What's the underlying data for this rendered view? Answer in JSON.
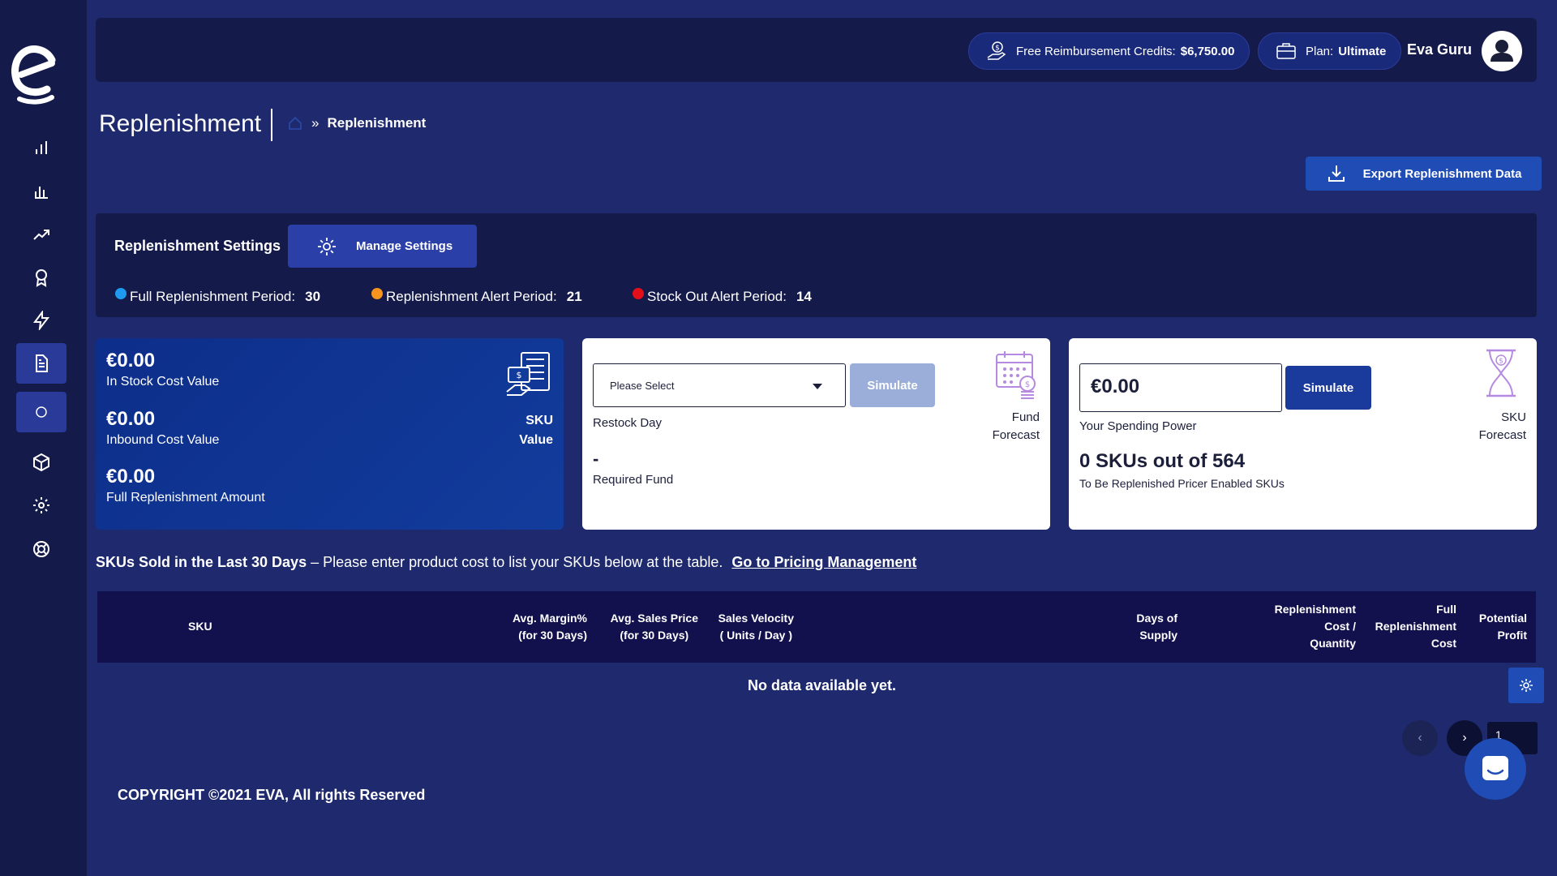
{
  "header": {
    "credits_label": "Free Reimbursement Credits:",
    "credits_value": "$6,750.00",
    "plan_label": "Plan:",
    "plan_value": "Ultimate",
    "user_name": "Eva Guru"
  },
  "page": {
    "title": "Replenishment",
    "breadcrumb_current": "Replenishment",
    "breadcrumb_separator": "»",
    "export_label": "Export Replenishment Data"
  },
  "settings": {
    "title": "Replenishment Settings",
    "manage_label": "Manage Settings",
    "full_period_label": "Full Replenishment Period:",
    "full_period_value": "30",
    "alert_period_label": "Replenishment Alert Period:",
    "alert_period_value": "21",
    "stockout_period_label": "Stock Out Alert Period:",
    "stockout_period_value": "14",
    "colors": {
      "full": "#1e9bf0",
      "alert": "#f7941d",
      "stockout": "#e3101a"
    }
  },
  "sku_value_card": {
    "in_stock_value": "€0.00",
    "in_stock_label": "In Stock Cost Value",
    "inbound_value": "€0.00",
    "inbound_label": "Inbound Cost Value",
    "full_amount_value": "€0.00",
    "full_amount_label": "Full Replenishment Amount",
    "corner_line1": "SKU",
    "corner_line2": "Value",
    "icon": "money-document-icon"
  },
  "fund_forecast_card": {
    "select_value": "Please Select",
    "simulate_label": "Simulate",
    "restock_label": "Restock Day",
    "required_fund_value": "-",
    "required_fund_label": "Required Fund",
    "corner_line1": "Fund",
    "corner_line2": "Forecast",
    "icon": "calendar-coin-icon"
  },
  "sku_forecast_card": {
    "spending_value": "€0.00",
    "simulate_label": "Simulate",
    "spending_label": "Your Spending Power",
    "skus_result": "0 SKUs out of 564",
    "skus_result_label": "To Be Replenished Pricer Enabled SKUs",
    "corner_line1": "SKU",
    "corner_line2": "Forecast",
    "icon": "hourglass-dollar-icon"
  },
  "skus_section": {
    "heading_bold": "SKUs Sold in the Last 30 Days",
    "heading_text": " – Please enter product cost to list your SKUs below at the table.",
    "link_label": "Go to Pricing Management"
  },
  "table": {
    "columns": [
      [
        "SKU"
      ],
      [
        "Avg. Margin%",
        "(for 30 Days)"
      ],
      [
        "Avg. Sales Price",
        "(for 30 Days)"
      ],
      [
        "Sales Velocity",
        "( Units / Day )"
      ],
      [
        "Days of",
        "Supply"
      ],
      [
        "Replenishment",
        "Cost /",
        "Quantity"
      ],
      [
        "Full",
        "Replenishment",
        "Cost"
      ],
      [
        "Potential",
        "Profit"
      ]
    ],
    "empty_message": "No data available yet.",
    "page": "1"
  },
  "footer": {
    "copyright": "COPYRIGHT ©2021 EVA, All rights Reserved"
  }
}
